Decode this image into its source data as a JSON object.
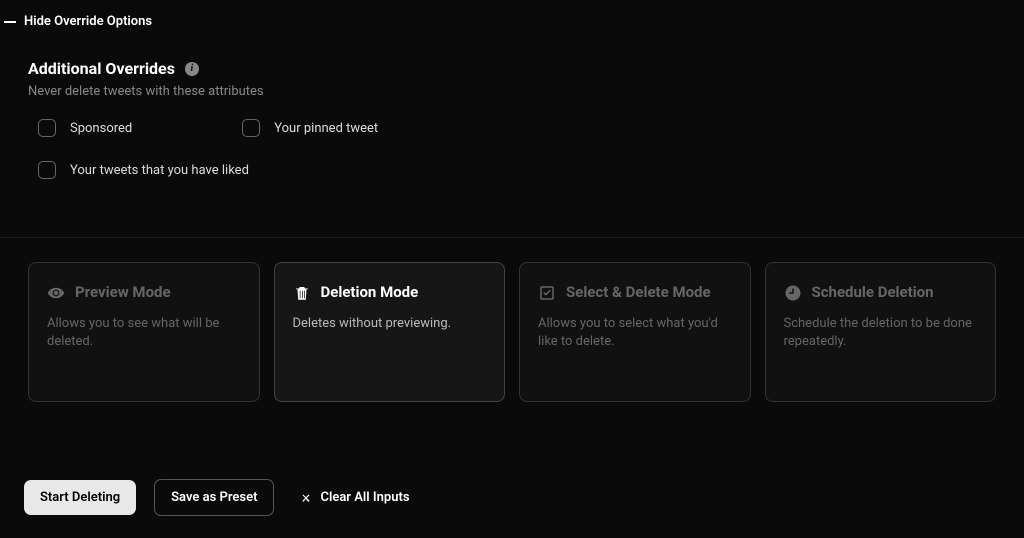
{
  "hide_override_label": "Hide Override Options",
  "overrides": {
    "title": "Additional Overrides",
    "subtitle": "Never delete tweets with these attributes",
    "items": [
      {
        "label": "Sponsored"
      },
      {
        "label": "Your pinned tweet"
      },
      {
        "label": "Your tweets that you have liked"
      }
    ]
  },
  "modes": [
    {
      "title": "Preview Mode",
      "desc": "Allows you to see what will be deleted."
    },
    {
      "title": "Deletion Mode",
      "desc": "Deletes without previewing."
    },
    {
      "title": "Select & Delete Mode",
      "desc": "Allows you to select what you'd like to delete."
    },
    {
      "title": "Schedule Deletion",
      "desc": "Schedule the deletion to be done repeatedly."
    }
  ],
  "actions": {
    "start": "Start Deleting",
    "save_preset": "Save as Preset",
    "clear": "Clear All Inputs"
  }
}
